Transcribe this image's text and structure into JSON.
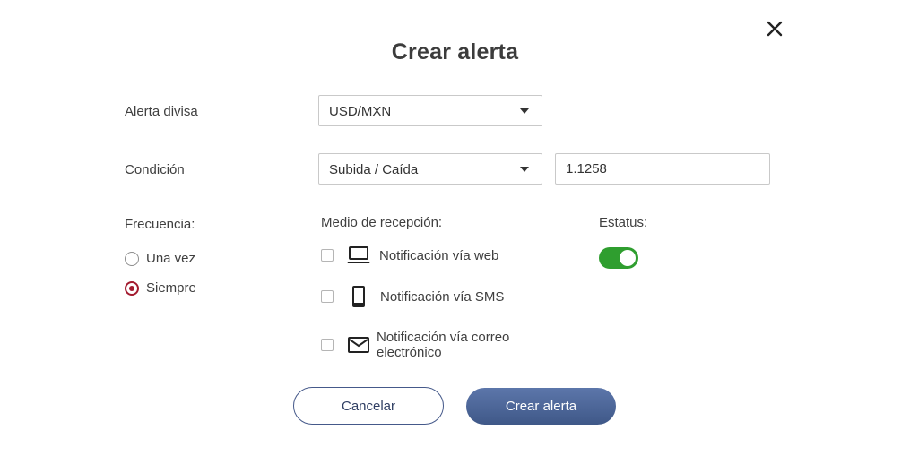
{
  "dialog": {
    "title": "Crear alerta",
    "close_icon": "close-icon"
  },
  "form": {
    "currency": {
      "label": "Alerta divisa",
      "value": "USD/MXN"
    },
    "condition": {
      "label": "Condición",
      "value": "Subida / Caída",
      "amount": "1.1258"
    },
    "frequency": {
      "label": "Frecuencia:",
      "options": [
        {
          "label": "Una vez",
          "checked": false
        },
        {
          "label": "Siempre",
          "checked": true
        }
      ]
    },
    "channels": {
      "label": "Medio de recepción:",
      "options": [
        {
          "label": "Notificación vía web",
          "icon": "laptop-icon",
          "checked": false
        },
        {
          "label": "Notificación vía SMS",
          "icon": "phone-icon",
          "checked": false
        },
        {
          "label": "Notificación vía correo electrónico",
          "icon": "mail-icon",
          "checked": false
        }
      ]
    },
    "status": {
      "label": "Estatus:",
      "enabled": true
    }
  },
  "actions": {
    "cancel_label": "Cancelar",
    "submit_label": "Crear alerta"
  },
  "colors": {
    "accent_radio": "#a31b2f",
    "toggle_on": "#2f9e2f",
    "primary_button": "#4d6699"
  }
}
